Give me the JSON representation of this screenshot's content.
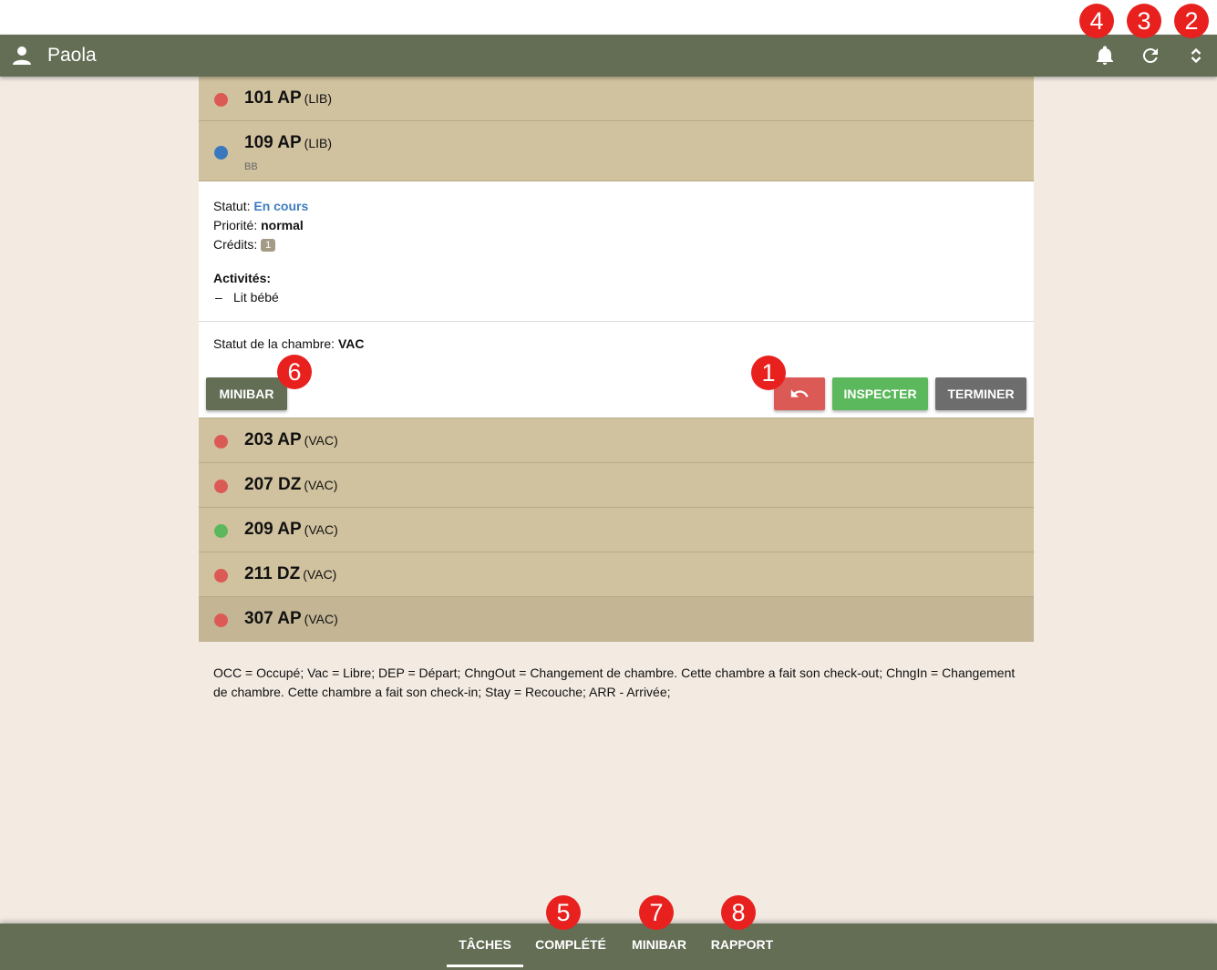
{
  "user": {
    "name": "Paola"
  },
  "header": {
    "icons": [
      "bell-icon",
      "refresh-icon",
      "expand-collapse-icon"
    ]
  },
  "rooms": [
    {
      "number": "101 AP",
      "tag": "(LIB)",
      "dot_color": "#dc5a55"
    },
    {
      "number": "109 AP",
      "tag": "(LIB)",
      "dot_color": "#3a78bd",
      "sub": "BB"
    },
    {
      "number": "203 AP",
      "tag": "(VAC)",
      "dot_color": "#dc5a55"
    },
    {
      "number": "207 DZ",
      "tag": "(VAC)",
      "dot_color": "#dc5a55"
    },
    {
      "number": "209 AP",
      "tag": "(VAC)",
      "dot_color": "#5cb85c"
    },
    {
      "number": "211 DZ",
      "tag": "(VAC)",
      "dot_color": "#dc5a55"
    },
    {
      "number": "307 AP",
      "tag": "(VAC)",
      "dot_color": "#dc5a55"
    }
  ],
  "detail": {
    "status_label": "Statut:",
    "status_value": "En cours",
    "priority_label": "Priorité:",
    "priority_value": "normal",
    "credits_label": "Crédits:",
    "credits_value": "1",
    "activities_label": "Activités:",
    "activities": [
      {
        "dash": "–",
        "text": "Lit bébé"
      }
    ],
    "room_status_label": "Statut de la chambre:",
    "room_status_value": "VAC",
    "buttons": {
      "minibar": "MINIBAR",
      "inspect": "INSPECTER",
      "finish": "TERMINER"
    }
  },
  "legend": "OCC = Occupé; Vac = Libre; DEP = Départ; ChngOut = Changement de chambre. Cette chambre a fait son check-out; ChngIn = Changement de chambre. Cette chambre a fait son check-in; Stay = Recouche; ARR - Arrivée;",
  "tabs": [
    {
      "label": "TÂCHES",
      "active": true
    },
    {
      "label": "COMPLÉTÉ",
      "active": false
    },
    {
      "label": "MINIBAR",
      "active": false
    },
    {
      "label": "RAPPORT",
      "active": false
    }
  ],
  "markers": [
    "1",
    "2",
    "3",
    "4",
    "5",
    "6",
    "7",
    "8"
  ],
  "colors": {
    "bar": "#636e55",
    "row": "#d1c29f",
    "background": "#f3ebe2",
    "marker": "#e8211f"
  }
}
